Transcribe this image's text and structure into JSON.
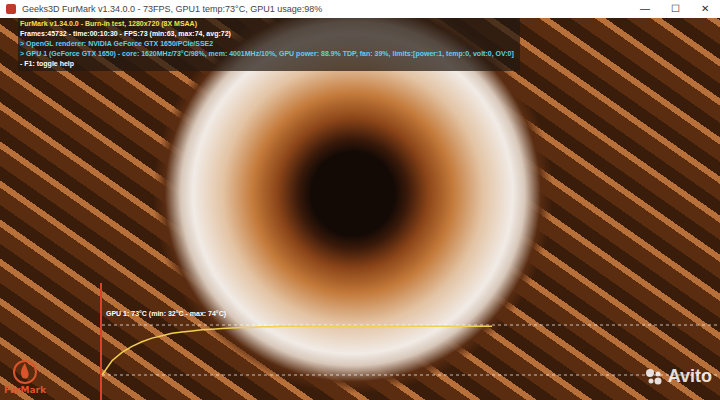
{
  "window": {
    "title": "Geeks3D FurMark v1.34.0.0 - 73FPS, GPU1 temp:73°C, GPU1 usage:98%",
    "controls": [
      "—",
      "☐",
      "✕"
    ]
  },
  "osd": {
    "lines": [
      {
        "text": "FurMark v1.34.0.0 - Burn-in test, 1280x720 (8X MSAA)",
        "color": "#f5e04a"
      },
      {
        "text": "Frames:45732 - time:00:10:30 - FPS:73 (min:63, max:74, avg:72)",
        "color": "#ffffff"
      },
      {
        "text": "> OpenGL renderer: NVIDIA GeForce GTX 1650/PCIe/SSE2",
        "color": "#5ad0f0"
      },
      {
        "text": "> GPU 1 (GeForce GTX 1650) - core: 1620MHz/73°C/98%, mem: 4001MHz/10%, GPU power: 88.9% TDP, fan: 39%, limits:[power:1, temp:0, volt:0, OV:0]",
        "color": "#5ad0f0"
      },
      {
        "text": "- F1: toggle help",
        "color": "#ffffff"
      }
    ]
  },
  "graph": {
    "label": "GPU 1: 73°C (min: 32°C - max: 74°C)",
    "reference_lines": [
      74,
      32
    ],
    "series": [
      {
        "name": "GPU 1",
        "values": [
          32,
          44,
          51,
          56,
          60,
          63,
          65,
          67,
          68,
          69,
          70,
          70.5,
          71,
          71.5,
          72,
          72,
          72.5,
          72.5,
          73,
          73,
          73,
          73,
          73,
          73,
          73,
          73,
          73,
          73,
          73,
          73,
          73,
          73,
          73,
          73,
          73,
          73,
          73,
          73,
          73,
          73
        ]
      }
    ]
  },
  "logo": {
    "text": "FurMark"
  },
  "watermark": {
    "text": "Avito"
  }
}
